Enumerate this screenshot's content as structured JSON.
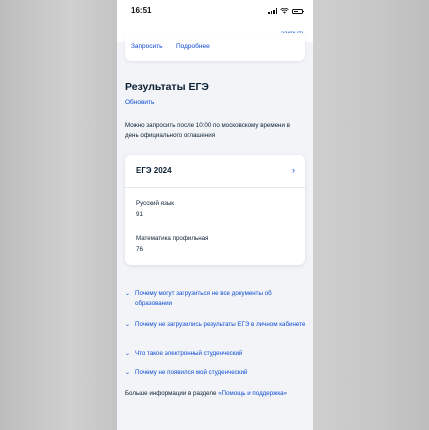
{
  "status_bar": {
    "time": "16:51"
  },
  "top_bar": {
    "close_label": "закрыть"
  },
  "previous_card": {
    "request_label": "Запросить",
    "details_label": "Подробнее"
  },
  "results": {
    "title": "Результаты ЕГЭ",
    "refresh_label": "Обновить",
    "hint": "Можно запросить после 10:00 по московскому времени в день официального оглашения"
  },
  "ege_card": {
    "title": "ЕГЭ 2024",
    "subjects": [
      {
        "name": "Русский язык",
        "score": "91"
      },
      {
        "name": "Математика профильная",
        "score": "76"
      }
    ]
  },
  "faq": [
    {
      "text": "Почему могут загрузиться не все документы об образовании"
    },
    {
      "text": "Почему не загрузились результаты ЕГЭ в личном кабинете"
    },
    {
      "text": "Что такое электронный студенческий"
    },
    {
      "text": "Почему не появился мой студенческий"
    }
  ],
  "more_info": {
    "prefix": "Больше информации в разделе ",
    "link": "«Помощь и поддержка»"
  },
  "colors": {
    "link": "#0d4cd3",
    "text": "#0b1f33",
    "page_bg": "#f2f4f8",
    "card_bg": "#ffffff"
  },
  "icons": [
    "chevron-right-icon",
    "chevron-down-icon",
    "signal-icon",
    "wifi-icon",
    "battery-icon"
  ]
}
